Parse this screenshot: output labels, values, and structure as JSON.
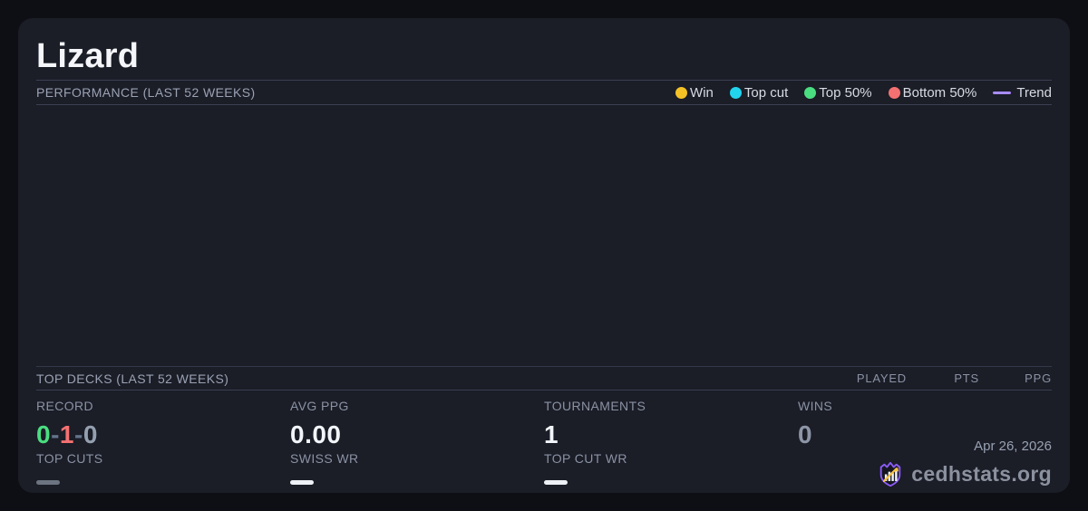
{
  "card": {
    "title": "Lizard"
  },
  "performance": {
    "heading": "PERFORMANCE (LAST 52 WEEKS)",
    "legend": [
      {
        "label": "Win",
        "type": "dot",
        "color": "#f5c226",
        "swatch_style": "background:#f5c226"
      },
      {
        "label": "Top cut",
        "type": "dot",
        "color": "#22d3ee",
        "swatch_style": "background:#22d3ee"
      },
      {
        "label": "Top 50%",
        "type": "dot",
        "color": "#4ade80",
        "swatch_style": "background:#4ade80"
      },
      {
        "label": "Bottom 50%",
        "type": "dot",
        "color": "#f47171",
        "swatch_style": "background:#f47171"
      },
      {
        "label": "Trend",
        "type": "line",
        "color": "#a78bfa",
        "swatch_style": "background:#a78bfa"
      }
    ],
    "chart_empty": true
  },
  "top_decks": {
    "heading": "TOP DECKS (LAST 52 WEEKS)",
    "columns": [
      "PLAYED",
      "PTS",
      "PPG"
    ],
    "rows": []
  },
  "stats": {
    "record": {
      "label": "RECORD",
      "wins": "0",
      "losses": "1",
      "draws": "0",
      "separator": "-"
    },
    "avg_ppg": {
      "label": "AVG PPG",
      "value": "0.00"
    },
    "tournaments": {
      "label": "TOURNAMENTS",
      "value": "1"
    },
    "wins": {
      "label": "WINS",
      "value": "0"
    },
    "top_cuts": {
      "label": "TOP CUTS",
      "value": "",
      "dash_style": "background:#6b7480"
    },
    "swiss_wr": {
      "label": "SWISS WR",
      "value": "",
      "dash_style": "background:#eef1f5"
    },
    "top_cut_wr": {
      "label": "TOP CUT WR",
      "value": "",
      "dash_style": "background:#eef1f5"
    }
  },
  "footer": {
    "date": "Apr 26, 2026",
    "brand": "cedhstats.org"
  },
  "colors": {
    "page_bg": "#0e0f14",
    "card_bg": "#1b1d27",
    "divider": "#3b4052",
    "text_primary": "#f2f5f9",
    "text_muted": "#8a92a4",
    "win_green": "#4ade80",
    "loss_red": "#f47171",
    "draw_gray": "#94a0b0",
    "logo_purple": "#8b5cf6",
    "logo_gold": "#f6c244"
  }
}
